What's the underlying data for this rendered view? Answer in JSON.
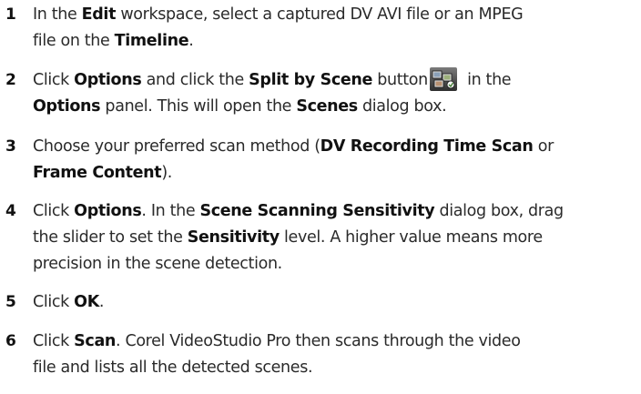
{
  "steps": [
    {
      "number": "1",
      "t1": "In the ",
      "b1": "Edit",
      "t2": " workspace, select a captured DV AVI file or an MPEG",
      "t3": "file on the ",
      "b2": "Timeline",
      "t4": "."
    },
    {
      "number": "2",
      "t1": "Click ",
      "b1": "Options",
      "t2": " and click the ",
      "b2": "Split by Scene",
      "t3": " button",
      "icon": "split-by-scene-icon",
      "t4": " in the",
      "b3": "Options",
      "t5": " panel. This will open the ",
      "b4": "Scenes",
      "t6": " dialog box."
    },
    {
      "number": "3",
      "t1": "Choose your preferred scan method (",
      "b1": "DV Recording Time Scan",
      "t2": " or",
      "b2": "Frame Content",
      "t3": ")."
    },
    {
      "number": "4",
      "t1": "Click ",
      "b1": "Options",
      "t2": ". In the ",
      "b2": "Scene Scanning Sensitivity",
      "t3": " dialog box, drag",
      "t4": "the slider to set the ",
      "b3": "Sensitivity",
      "t5": " level. A higher value means more",
      "t6": "precision in the scene detection."
    },
    {
      "number": "5",
      "t1": "Click ",
      "b1": "OK",
      "t2": "."
    },
    {
      "number": "6",
      "t1": "Click ",
      "b1": "Scan",
      "t2": ". Corel VideoStudio Pro then scans through the video",
      "t3": "file and lists all the detected scenes."
    }
  ]
}
